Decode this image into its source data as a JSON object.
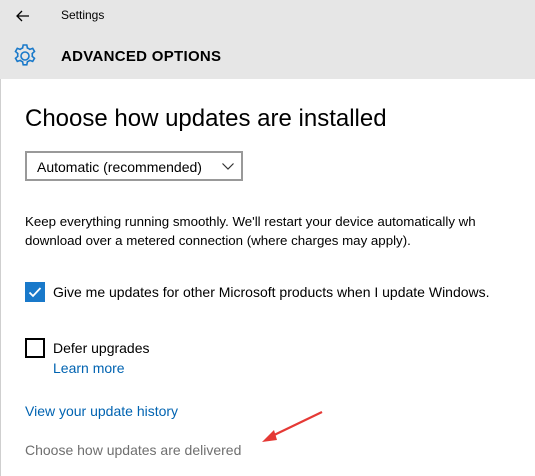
{
  "window": {
    "app_title": "Settings",
    "back_icon": "back-arrow-icon"
  },
  "header": {
    "icon": "gear-icon",
    "title": "ADVANCED OPTIONS"
  },
  "main": {
    "heading": "Choose how updates are installed",
    "install_mode": {
      "selected": "Automatic (recommended)"
    },
    "description_lines": [
      "Keep everything running smoothly. We'll restart your device automatically wh",
      "download over a metered connection (where charges may apply)."
    ],
    "options": {
      "microsoft_products": {
        "label": "Give me updates for other Microsoft products when I update Windows.",
        "checked": true
      },
      "defer_upgrades": {
        "label": "Defer upgrades",
        "checked": false,
        "learn_more": "Learn more"
      }
    },
    "update_history_link": "View your update history",
    "delivery_link": "Choose how updates are delivered"
  },
  "colors": {
    "accent": "#1979ca",
    "link": "#0063b1",
    "header_bg": "#e6e6e6",
    "annotation_arrow": "#e53935",
    "muted_link": "#6f6f6f"
  }
}
